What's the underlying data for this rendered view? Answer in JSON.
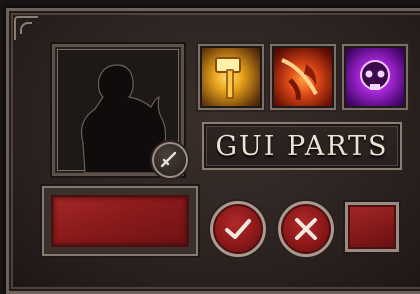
{
  "title": {
    "text": "GUI PARTS"
  },
  "portrait": {
    "icon": "character-silhouette-icon",
    "badge_icon": "sword-icon"
  },
  "skills": [
    {
      "icon": "hammer-icon",
      "color": "#e9a51b"
    },
    {
      "icon": "fire-slash-icon",
      "color": "#d84415"
    },
    {
      "icon": "purple-skull-icon",
      "color": "#a626d6"
    }
  ],
  "buttons": {
    "confirm_icon": "checkmark-icon",
    "cancel_icon": "close-icon"
  },
  "colors": {
    "panel": "#2b2220",
    "frame": "#8b7e74",
    "accent_red": "#8b1a1b",
    "title_text": "#ece2d4"
  }
}
